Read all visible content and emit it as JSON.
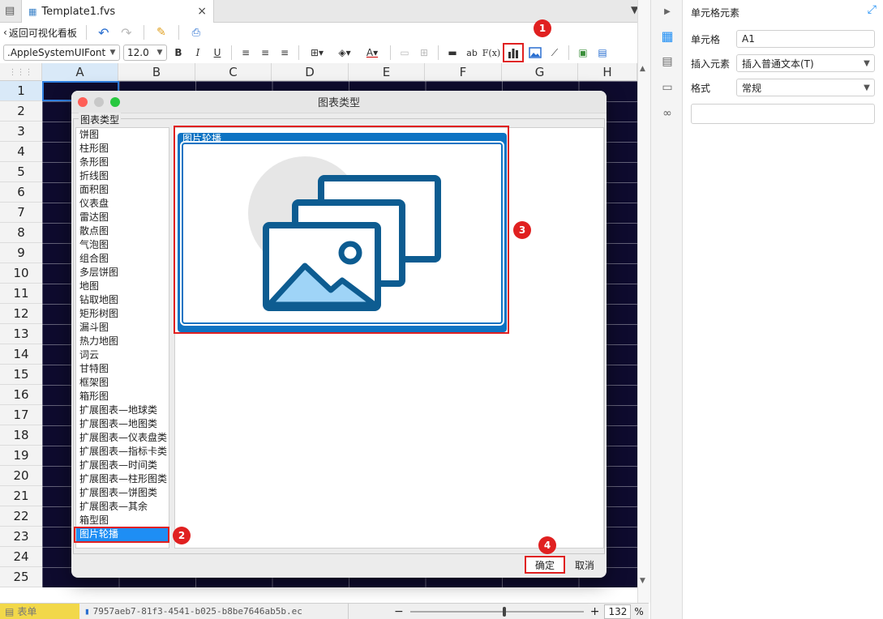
{
  "tab": {
    "title": "Template1.fvs",
    "close": "×"
  },
  "toolbar": {
    "back_label": "返回可视化看板",
    "font_name": ".AppleSystemUIFont",
    "font_size": "12.0",
    "bold": "B",
    "italic": "I",
    "underline": "U",
    "ab": "ab",
    "fx": "F(x)"
  },
  "grid": {
    "columns": [
      "A",
      "B",
      "C",
      "D",
      "E",
      "F",
      "G",
      "H"
    ],
    "rows": [
      "1",
      "2",
      "3",
      "4",
      "5",
      "6",
      "7",
      "8",
      "9",
      "10",
      "11",
      "12",
      "13",
      "14",
      "15",
      "16",
      "17",
      "18",
      "19",
      "20",
      "21",
      "22",
      "23",
      "24",
      "25"
    ]
  },
  "bottom": {
    "sheet_tab": "表单",
    "file_id": "7957aeb7-81f3-4541-b025-b8be7646ab5b.ec",
    "zoom_value": "132",
    "zoom_unit": "%",
    "zoom_minus": "−",
    "zoom_plus": "+"
  },
  "panel": {
    "title": "单元格元素",
    "cell_label": "单元格",
    "cell_value": "A1",
    "insert_label": "插入元素",
    "insert_value": "插入普通文本(T)",
    "format_label": "格式",
    "format_value": "常规",
    "textarea_value": ""
  },
  "dialog": {
    "title": "图表类型",
    "group_label": "图表类型",
    "chart_types": [
      "饼图",
      "柱形图",
      "条形图",
      "折线图",
      "面积图",
      "仪表盘",
      "雷达图",
      "散点图",
      "气泡图",
      "组合图",
      "多层饼图",
      "地图",
      "钻取地图",
      "矩形树图",
      "漏斗图",
      "热力地图",
      "词云",
      "甘特图",
      "框架图",
      "箱形图",
      "扩展图表—地球类",
      "扩展图表—地图类",
      "扩展图表—仪表盘类",
      "扩展图表—指标卡类",
      "扩展图表—时间类",
      "扩展图表—柱形图类",
      "扩展图表—饼图类",
      "扩展图表—其余",
      "箱型图",
      "图片轮播"
    ],
    "selected_index": 29,
    "preview_title": "图片轮播",
    "ok_label": "确定",
    "cancel_label": "取消"
  },
  "annotations": [
    "1",
    "2",
    "3",
    "4"
  ],
  "colors": {
    "accent": "#1e8ef4",
    "card_blue": "#0d73c3",
    "marker_red": "#e02020",
    "grid_bg": "#0e0b2e"
  }
}
